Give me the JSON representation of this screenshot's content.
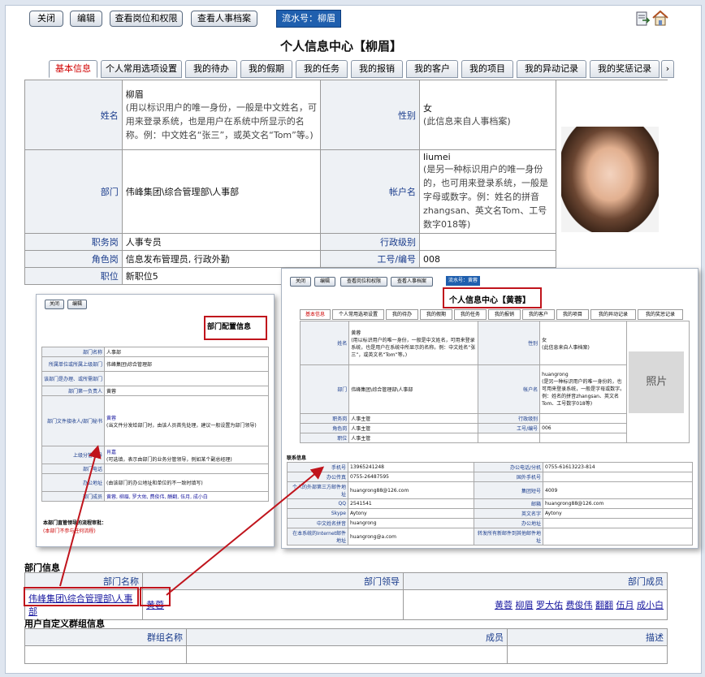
{
  "toolbar": {
    "close": "关闭",
    "edit": "编辑",
    "view_posts": "查看岗位和权限",
    "view_hr": "查看人事档案",
    "serial": "流水号：柳眉"
  },
  "page_title": "个人信息中心【柳眉】",
  "tabs": [
    "基本信息",
    "个人常用选项设置",
    "我的待办",
    "我的假期",
    "我的任务",
    "我的报销",
    "我的客户",
    "我的项目",
    "我的异动记录",
    "我的奖惩记录"
  ],
  "basic": {
    "name_label": "姓名",
    "name_value": "柳眉",
    "name_note": "(用以标识用户的唯一身份，一般是中文姓名，可用来登录系统，也是用户在系统中所显示的名称。例：中文姓名“张三”，或英文名“Tom”等。)",
    "gender_label": "性别",
    "gender_value": "女",
    "gender_note": "(此信息来自人事档案)",
    "dept_label": "部门",
    "dept_value": "伟峰集团\\综合管理部\\人事部",
    "account_label": "帐户名",
    "account_value": "liumei",
    "account_note": "(是另一种标识用户的唯一身份的，也可用来登录系统，一般是字母或数字。例：姓名的拼音zhangsan、英文名Tom、工号数字018等)",
    "duty_label": "职务岗",
    "duty_value": "人事专员",
    "admin_label": "行政级别",
    "admin_value": "",
    "role_label": "角色岗",
    "role_value": "信息发布管理员, 行政外勤",
    "jobno_label": "工号/编号",
    "jobno_value": "008",
    "position_label": "职位",
    "position_value": "新职位5"
  },
  "dept_inset": {
    "close": "关闭",
    "edit": "编辑",
    "title": "部门配置信息",
    "rows": [
      {
        "label": "部门名称",
        "value": "人事部"
      },
      {
        "label": "所属单位或所属上级部门",
        "value": "伟峰集团\\综合管理部"
      },
      {
        "label": "该部门是办理、或所需部门",
        "value": ""
      },
      {
        "label": "部门第一负责人",
        "value": "黄蓉"
      },
      {
        "label": "部门文件接收人/部门秘书",
        "value": "黄蓉",
        "note": "(当文件分发给部门时，由该人员首先处理，建议一般设置为部门领导)"
      },
      {
        "label": "上级分管领导",
        "value": "肖嘉",
        "note": "(可选填，表示由部门的业务分管领导，例如某个副总经理)"
      },
      {
        "label": "部门电话",
        "value": ""
      },
      {
        "label": "办公地址",
        "value": "",
        "note": "(由该部门的办公地址和单位的不一致时填写)"
      },
      {
        "label": "部门成员",
        "value": "黄蓉, 柳眉, 罗大佑, 费俊伟, 酬翻, 伍月, 成小白"
      }
    ],
    "footer": "本部门直管领导的流程审批：",
    "footer_note": "(本部门不参与任何流程)"
  },
  "person_inset": {
    "close": "关闭",
    "edit": "编辑",
    "view_posts": "查看岗位和权限",
    "view_hr": "查看人事档案",
    "serial": "流水号：黄蓉",
    "title": "个人信息中心【黄蓉】",
    "tabs": [
      "基本信息",
      "个人常用选项设置",
      "我的待办",
      "我的假期",
      "我的任务",
      "我的报销",
      "我的客户",
      "我的项目",
      "我的异动记录",
      "我的奖惩记录"
    ],
    "name_label": "姓名",
    "name_value": "黄蓉",
    "name_note": "(用以标识用户的唯一身份，一般是中文姓名，可用来登录系统，也是用户在系统中所显示的名称。例：中文姓名“张三”，或英文名“Tom”等。)",
    "gender_label": "性别",
    "gender_value": "女",
    "gender_note": "(此信息来自人事档案)",
    "dept_label": "部门",
    "dept_value": "伟峰集团\\综合管理部\\人事部",
    "account_label": "帐户名",
    "account_value": "huangrong",
    "account_note": "(是另一种标识用户的唯一身份的，也可用来登录系统，一般是字母或数字。例：姓名的拼音zhangsan、英文名Tom、工号数字018等)",
    "photo_text": "照片",
    "duty_label": "职务岗",
    "duty_value": "人事主管",
    "admin_label": "行政级别",
    "admin_value": "",
    "role_label": "角色岗",
    "role_value": "人事主管",
    "jobno_label": "工号/编号",
    "jobno_value": "006",
    "position_label": "职位",
    "position_value": "人事主管",
    "contact_title": "联系信息",
    "contact": [
      [
        "手机号",
        "13965241248",
        "办公电话/分机",
        "0755-61613223-814"
      ],
      [
        "办公传真",
        "0755-26487595",
        "国外手机号",
        ""
      ],
      [
        "个人的外部第三方邮件地址",
        "huangrong88@126.com",
        "集团短号",
        "4009"
      ],
      [
        "QQ",
        "2541541",
        "邮箱",
        "huangrong88@126.com"
      ],
      [
        "Skype",
        "Aytony",
        "英文名字",
        "Aytony"
      ],
      [
        "中文姓名拼音",
        "huangrong",
        "办公地址",
        ""
      ],
      [
        "在本系统的Internet邮件地址",
        "huangrong@a.com",
        "转发所有新邮件到其他邮件地址",
        ""
      ]
    ]
  },
  "dept_section": {
    "title": "部门信息",
    "col_name": "部门名称",
    "col_leader": "部门领导",
    "col_members": "部门成员",
    "dept_name": "伟峰集团\\综合管理部\\人事部",
    "leader": "黄蓉",
    "members": [
      "黄蓉",
      "柳眉",
      "罗大佑",
      "费俊伟",
      "翻翻",
      "伍月",
      "成小白"
    ]
  },
  "group_section": {
    "title": "用户自定义群组信息",
    "col_name": "群组名称",
    "col_members": "成员",
    "col_desc": "描述"
  }
}
